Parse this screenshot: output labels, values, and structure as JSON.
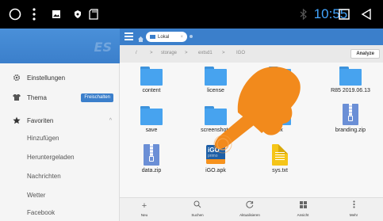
{
  "status_bar": {
    "time": "10:55",
    "icons": [
      "circle-icon",
      "more-vert-icon",
      "image-icon",
      "shield-icon",
      "sd-card-icon",
      "bluetooth-icon",
      "square-icon",
      "back-icon"
    ]
  },
  "sidebar": {
    "brand": "ES",
    "items": [
      {
        "label": "Einstellungen",
        "icon": "gear-icon"
      },
      {
        "label": "Thema",
        "icon": "shirt-icon",
        "badge": "Freischalten"
      },
      {
        "label": "Favoriten",
        "icon": "star-icon"
      },
      {
        "label": "Hinzufügen"
      },
      {
        "label": "Heruntergeladen"
      },
      {
        "label": "Nachrichten"
      },
      {
        "label": "Wetter"
      },
      {
        "label": "Facebook"
      }
    ]
  },
  "topbar": {
    "tab_label": "Lokal"
  },
  "breadcrumb": {
    "items": [
      "/",
      ">",
      "storage",
      ">",
      "extsd1",
      ">",
      "IGO"
    ],
    "analyze_label": "Analyze"
  },
  "files": [
    {
      "name": "content",
      "type": "folder"
    },
    {
      "name": "license",
      "type": "folder"
    },
    {
      "name": "",
      "type": "folder"
    },
    {
      "name": "R85 2019.06.13",
      "type": "folder"
    },
    {
      "name": "save",
      "type": "folder"
    },
    {
      "name": "screenshots",
      "type": "folder"
    },
    {
      "name": "ux",
      "type": "folder"
    },
    {
      "name": "branding.zip",
      "type": "zip"
    },
    {
      "name": "data.zip",
      "type": "zip"
    },
    {
      "name": "iGO.apk",
      "type": "apk",
      "icon_text": "iGO",
      "icon_subtext": "primo"
    },
    {
      "name": "sys.txt",
      "type": "txt"
    }
  ],
  "toolbar": {
    "items": [
      {
        "label": "Neu",
        "icon": "plus-icon"
      },
      {
        "label": "Suchen",
        "icon": "search-icon"
      },
      {
        "label": "Aktualisieren",
        "icon": "refresh-icon"
      },
      {
        "label": "Ansicht",
        "icon": "grid-view-icon"
      },
      {
        "label": "Mehr",
        "icon": "more-vert-icon"
      }
    ]
  },
  "colors": {
    "accent": "#3b7fcb",
    "folder": "#47a3ef",
    "hand": "#f28a1c",
    "clock": "#42a5ff"
  }
}
